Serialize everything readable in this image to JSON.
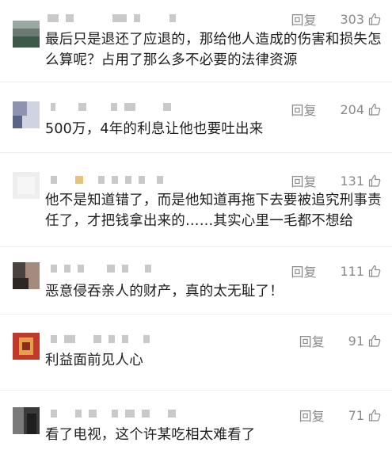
{
  "comments": [
    {
      "reply_label": "回复",
      "likes": "303",
      "text": "最后只是退还了应退的，那给他人造成的伤害和损失怎么算呢？占用了那么多不必要的法律资源",
      "avatar_colors": [
        "#6a7a72",
        "#3d5a48",
        "#9aa8a2"
      ]
    },
    {
      "reply_label": "回复",
      "likes": "204",
      "text": "500万，4年的利息让他也要吐出来",
      "avatar_colors": [
        "#8e94b0",
        "#cfd3e2",
        "#5b6486"
      ]
    },
    {
      "reply_label": "回复",
      "likes": "131",
      "text": "他不是知道错了，而是他知道再拖下去要被追究刑事责任了，才把钱拿出来的……其实心里一毛都不想给",
      "avatar_colors": [
        "#eeeeee",
        "#f6f6f6",
        "#e2e2e2"
      ]
    },
    {
      "reply_label": "回复",
      "likes": "111",
      "text": "恶意侵吞亲人的财产，真的太无耻了！",
      "avatar_colors": [
        "#4a4240",
        "#a58a7e",
        "#2c2624"
      ]
    },
    {
      "reply_label": "回复",
      "likes": "91",
      "text": "利益面前见人心",
      "avatar_colors": [
        "#c0392b",
        "#e6a04c",
        "#8e2b1e"
      ]
    },
    {
      "reply_label": "回复",
      "likes": "71",
      "text": "看了电视，这个许某吃相太难看了",
      "avatar_colors": [
        "#3a3a3a",
        "#7a7a7a",
        "#1e1e1e"
      ]
    }
  ]
}
